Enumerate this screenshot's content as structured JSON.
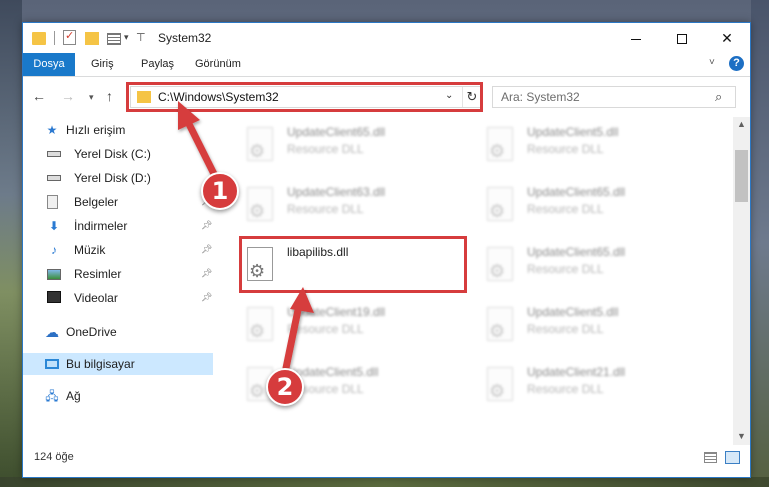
{
  "window": {
    "title": "System32",
    "minimize_label": "",
    "maximize_label": "",
    "close_label": "✕"
  },
  "ribbon": {
    "tabs": [
      "Dosya",
      "Giriş",
      "Paylaş",
      "Görünüm"
    ],
    "help_label": "?"
  },
  "address": {
    "path": "C:\\Windows\\System32",
    "refresh": "↻"
  },
  "search": {
    "placeholder": "Ara: System32"
  },
  "sidebar": {
    "items": [
      {
        "label": "Hızlı erişim",
        "icon": "star-icon"
      },
      {
        "label": "Yerel Disk (C:)",
        "icon": "drive-icon"
      },
      {
        "label": "Yerel Disk (D:)",
        "icon": "drive-icon"
      },
      {
        "label": "Belgeler",
        "icon": "document-icon"
      },
      {
        "label": "İndirmeler",
        "icon": "download-icon"
      },
      {
        "label": "Müzik",
        "icon": "music-icon"
      },
      {
        "label": "Resimler",
        "icon": "pictures-icon"
      },
      {
        "label": "Videolar",
        "icon": "video-icon"
      },
      {
        "label": "OneDrive",
        "icon": "cloud-icon"
      },
      {
        "label": "Bu bilgisayar",
        "icon": "computer-icon"
      },
      {
        "label": "Ağ",
        "icon": "network-icon"
      }
    ]
  },
  "files": [
    {
      "name": "UpdateClient65.dll",
      "desc": "Resource DLL"
    },
    {
      "name": "UpdateClient5.dll",
      "desc": "Resource DLL"
    },
    {
      "name": "UpdateClient63.dll",
      "desc": "Resource DLL"
    },
    {
      "name": "UpdateClient65.dll",
      "desc": "Resource DLL"
    },
    {
      "name": "libapilibs.dll",
      "desc": ""
    },
    {
      "name": "UpdateClient65.dll",
      "desc": "Resource DLL"
    },
    {
      "name": "UpdateClient19.dll",
      "desc": "Resource DLL"
    },
    {
      "name": "UpdateClient5.dll",
      "desc": "Resource DLL"
    },
    {
      "name": "UpdateClient5.dll",
      "desc": "Resource DLL"
    },
    {
      "name": "UpdateClient21.dll",
      "desc": "Resource DLL"
    }
  ],
  "status": {
    "count": "124 öğe"
  },
  "annotations": {
    "step1": "1",
    "step2": "2",
    "color": "#d63c3d"
  }
}
